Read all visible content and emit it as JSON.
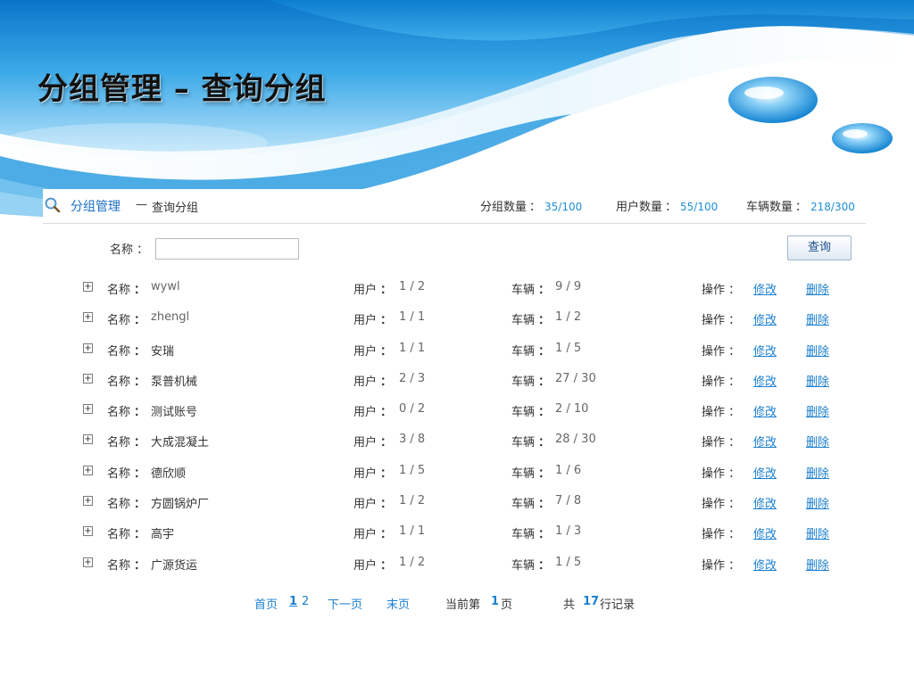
{
  "slide": {
    "title": "分组管理 – 查询分组"
  },
  "breadcrumb": {
    "link": "分组管理",
    "separator": "—",
    "current": "查询分组"
  },
  "stats": {
    "groups": {
      "label": "分组数量",
      "value": "35/100"
    },
    "users": {
      "label": "用户数量",
      "value": "55/100"
    },
    "vehicles": {
      "label": "车辆数量",
      "value": "218/300"
    },
    "colon": "："
  },
  "filter": {
    "label": "名称 ：",
    "value": "",
    "placeholder": ""
  },
  "query_button": "查询",
  "row_labels": {
    "name": "名称",
    "users": "用户",
    "vehicles": "车辆",
    "ops": "操作 ：",
    "edit": "修改",
    "delete": "删除",
    "colon": "：",
    "expand": "+"
  },
  "rows": [
    {
      "name": "wywl",
      "users": "1 / 2",
      "vehicles": "9 / 9"
    },
    {
      "name": "zhengl",
      "users": "1 / 1",
      "vehicles": "1 / 2"
    },
    {
      "name": "安瑞",
      "users": "1 / 1",
      "vehicles": "1 / 5"
    },
    {
      "name": "泵普机械",
      "users": "2 / 3",
      "vehicles": "27 / 30"
    },
    {
      "name": "测试账号",
      "users": "0 / 2",
      "vehicles": "2 / 10"
    },
    {
      "name": "大成混凝土",
      "users": "3 / 8",
      "vehicles": "28 / 30"
    },
    {
      "name": "德欣顺",
      "users": "1 / 5",
      "vehicles": "1 / 6"
    },
    {
      "name": "方圆锅炉厂",
      "users": "1 / 2",
      "vehicles": "7 / 8"
    },
    {
      "name": "高宇",
      "users": "1 / 1",
      "vehicles": "1 / 3"
    },
    {
      "name": "广源货运",
      "users": "1 / 2",
      "vehicles": "1 / 5"
    }
  ],
  "pager": {
    "first": "首页",
    "page1": "1",
    "page2": "2",
    "next": "下一页",
    "last": "末页",
    "current_prefix": "当前第",
    "current_page": "1",
    "current_suffix": "页",
    "total_prefix": "共",
    "total_count": "17",
    "total_suffix": "行记录"
  },
  "colors": {
    "accent": "#1a7fd0",
    "value_blue": "#1f8fd8",
    "water": "#1b8fd6"
  },
  "icons": {
    "breadcrumb": "search-icon",
    "row_toggle": "expand-icon"
  }
}
